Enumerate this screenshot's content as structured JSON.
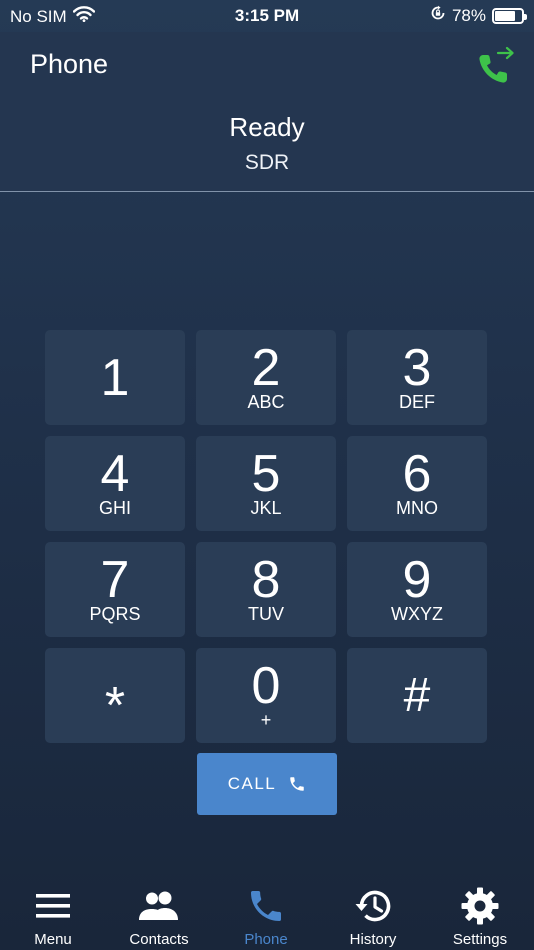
{
  "status_bar": {
    "carrier": "No SIM",
    "time": "3:15 PM",
    "battery_percent": "78%",
    "battery_level": 0.78,
    "icons": [
      "wifi-icon",
      "orientation-lock-icon",
      "battery-icon"
    ]
  },
  "header": {
    "title": "Phone",
    "state": "Ready",
    "mode": "SDR",
    "transfer_icon": "call-transfer-icon",
    "transfer_color": "#3ec24a"
  },
  "keypad": [
    {
      "digit": "1",
      "letters": ""
    },
    {
      "digit": "2",
      "letters": "ABC"
    },
    {
      "digit": "3",
      "letters": "DEF"
    },
    {
      "digit": "4",
      "letters": "GHI"
    },
    {
      "digit": "5",
      "letters": "JKL"
    },
    {
      "digit": "6",
      "letters": "MNO"
    },
    {
      "digit": "7",
      "letters": "PQRS"
    },
    {
      "digit": "8",
      "letters": "TUV"
    },
    {
      "digit": "9",
      "letters": "WXYZ"
    },
    {
      "digit": "*",
      "letters": ""
    },
    {
      "digit": "0",
      "letters": "+"
    },
    {
      "digit": "#",
      "letters": ""
    }
  ],
  "call_button": {
    "label": "CALL",
    "icon": "phone-icon",
    "color": "#4a86cc"
  },
  "nav": {
    "active_color": "#4a86cc",
    "items": [
      {
        "label": "Menu",
        "icon": "menu-icon"
      },
      {
        "label": "Contacts",
        "icon": "contacts-icon"
      },
      {
        "label": "Phone",
        "icon": "phone-icon",
        "active": true
      },
      {
        "label": "History",
        "icon": "history-icon"
      },
      {
        "label": "Settings",
        "icon": "gear-icon"
      }
    ]
  }
}
